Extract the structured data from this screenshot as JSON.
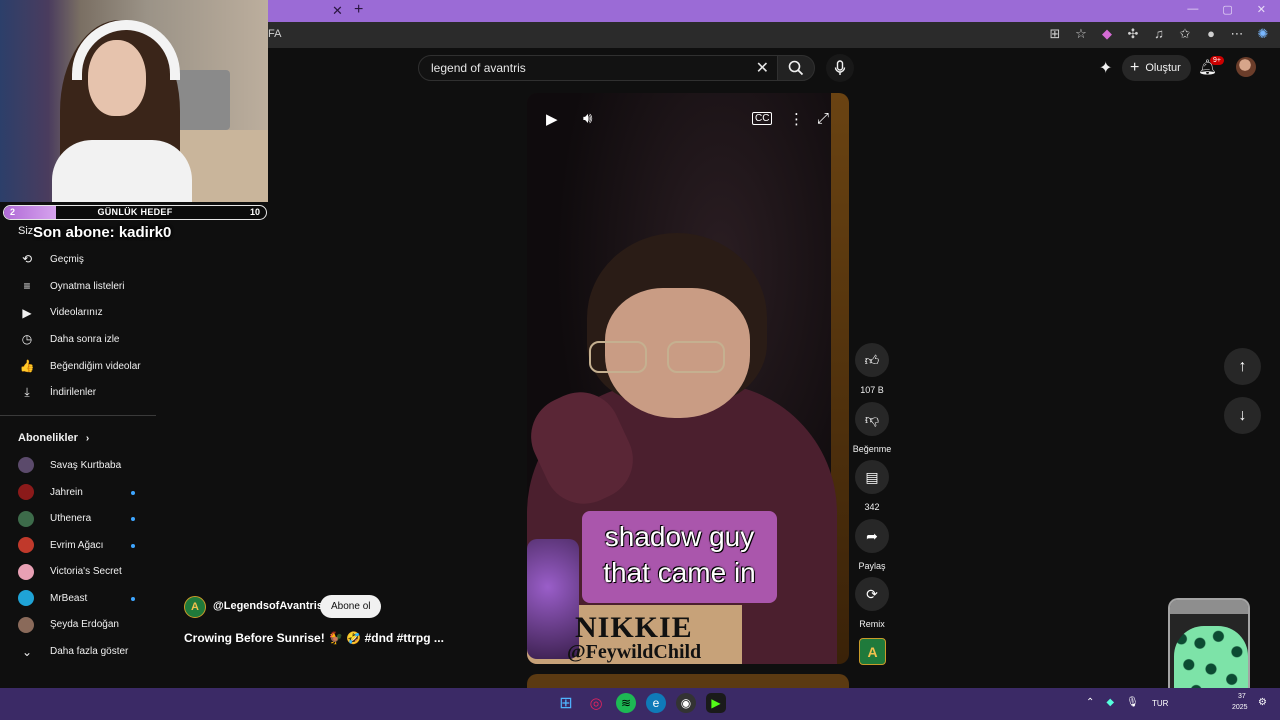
{
  "browser": {
    "url_fragment": "FA",
    "close_glyph": "✕",
    "new_tab_glyph": "+",
    "icons": [
      "split-screen-icon",
      "star-icon",
      "extension-icon",
      "puzzle-icon",
      "media-icon",
      "favorites-icon",
      "profile-icon",
      "more-icon",
      "copilot-icon"
    ]
  },
  "youtube": {
    "search_query": "legend of avantris",
    "create_label": "Oluştur",
    "notif_count": "9+"
  },
  "stream_overlay": {
    "goal_label": "GÜNLÜK HEDEF",
    "goal_current": "2",
    "goal_max": "10",
    "goal_fraction": 0.2,
    "last_sub_prefix": "Siz",
    "last_sub_text": "Son abone: kadirk0"
  },
  "sidebar": {
    "you_items": [
      {
        "icon": "⟲",
        "icon_name": "history-icon",
        "label": "Geçmiş"
      },
      {
        "icon": "≡",
        "icon_name": "playlists-icon",
        "label": "Oynatma listeleri"
      },
      {
        "icon": "▶",
        "icon_name": "your-videos-icon",
        "label": "Videolarınız"
      },
      {
        "icon": "◷",
        "icon_name": "watch-later-icon",
        "label": "Daha sonra izle"
      },
      {
        "icon": "👍",
        "icon_name": "liked-videos-icon",
        "label": "Beğendiğim videolar"
      },
      {
        "icon": "⤓",
        "icon_name": "downloads-icon",
        "label": "İndirilenler"
      }
    ],
    "subscriptions_title": "Abonelikler",
    "subscriptions": [
      {
        "label": "Savaş Kurtbaba",
        "color": "#5b4a6b",
        "live": false
      },
      {
        "label": "Jahrein",
        "color": "#8b1a1a",
        "live": true
      },
      {
        "label": "Uthenera",
        "color": "#3d6b4a",
        "live": true
      },
      {
        "label": "Evrim Ağacı",
        "color": "#c0392b",
        "live": true
      },
      {
        "label": "Victoria's Secret",
        "color": "#e8a0b4",
        "live": false
      },
      {
        "label": "MrBeast",
        "color": "#1fa3d6",
        "live": true
      },
      {
        "label": "Şeyda Erdoğan",
        "color": "#8a6a5a",
        "live": false
      }
    ],
    "show_more_label": "Daha fazla göster"
  },
  "video": {
    "caption_line1": "shadow guy",
    "caption_line2": "that came in",
    "name_main": "NIKKIE",
    "name_handle": "@FeywildChild",
    "channel_handle": "@LegendsofAvantris",
    "channel_initial": "A",
    "subscribe_label": "Abone ol",
    "title": "Crowing Before Sunrise! 🐓 🤣 #dnd #ttrpg ..."
  },
  "actions": {
    "likes": "107 B",
    "dislike_label": "Beğenme",
    "comments": "342",
    "share_label": "Paylaş",
    "remix_label": "Remix"
  },
  "taskbar": {
    "lang": "TUR",
    "clock_top": "37",
    "clock_bottom": "2025"
  }
}
